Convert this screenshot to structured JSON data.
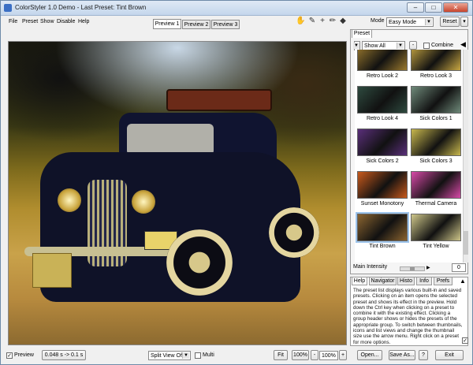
{
  "window": {
    "title": "ColorStyler 1.0 Demo - Last Preset: Tint Brown",
    "buttons": {
      "minimize": "–",
      "maximize": "□",
      "close": "✕"
    }
  },
  "menu": [
    "File",
    "Preset",
    "Show",
    "Disable",
    "Help"
  ],
  "preview_tabs": [
    "Preview 1",
    "Preview 2",
    "Preview 3"
  ],
  "tools": {
    "hand": "✋",
    "eyedropper": "✎",
    "crosshair": "+",
    "pencil": "✏",
    "diamond": "◆"
  },
  "mode": {
    "label": "Mode",
    "value": "Easy Mode"
  },
  "reset_label": "Reset",
  "preset_panel": {
    "tab": "Preset",
    "filter_value": "Show All",
    "minus_label": "-",
    "combine_label": "Combine",
    "thumbnails": [
      {
        "label": "Retro Look 2",
        "color": "#9b7a2e"
      },
      {
        "label": "Retro Look 3",
        "color": "#c9a843"
      },
      {
        "label": "Retro Look 4",
        "color": "#2e4a3f"
      },
      {
        "label": "Sick Colors 1",
        "color": "#6f8a7a"
      },
      {
        "label": "Sick Colors 2",
        "color": "#5a2f7a"
      },
      {
        "label": "Sick Colors 3",
        "color": "#c8b84e"
      },
      {
        "label": "Sunset Monotony",
        "color": "#c95a1c"
      },
      {
        "label": "Thermal Camera",
        "color": "#d84aa8"
      },
      {
        "label": "Tint Brown",
        "color": "#8a6430"
      },
      {
        "label": "Tint Yellow",
        "color": "#cfc78a"
      }
    ],
    "selected": "Tint Brown",
    "intensity_label": "Main Intensity",
    "intensity_value": "0",
    "intensity_percent": 50
  },
  "help_panel": {
    "tabs": [
      "Help",
      "Navigator",
      "Histo",
      "Info",
      "Prefs"
    ],
    "text": "The preset list displays various built-in and saved presets. Clicking on an item opens the selected preset and shows its effect in the preview. Hold down the Ctrl key when clicking on a preset to combine it with the existing effect. Clicking a group header shows or hides the presets of the appropriate group. To switch between thumbnails, icons and list views and change the thumbnail size use the arrow menu. Right click on a preset for more options."
  },
  "statusbar": {
    "preview_label": "Preview",
    "timing": "0.048 s -> 0.1 s",
    "split_view": "Split View Off",
    "multi_label": "Multi",
    "fit_label": "Fit",
    "zoom_1": "100%",
    "zoom_2": "100%",
    "minus": "-",
    "plus": "+",
    "open_label": "Open...",
    "save_label": "Save As...",
    "help_label": "?",
    "exit_label": "Exit"
  },
  "colors": {
    "selection": "#9ec4ea",
    "title_bar": "#c4d6ec"
  }
}
